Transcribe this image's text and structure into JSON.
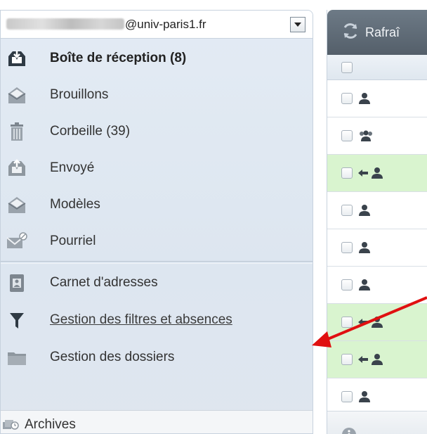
{
  "account": {
    "email_suffix": "@univ-paris1.fr"
  },
  "folders": [
    {
      "label": "Boîte de réception (8)",
      "icon": "inbox-icon",
      "selected": true
    },
    {
      "label": "Brouillons",
      "icon": "drafts-icon"
    },
    {
      "label": "Corbeille (39)",
      "icon": "trash-icon"
    },
    {
      "label": "Envoyé",
      "icon": "sent-icon"
    },
    {
      "label": "Modèles",
      "icon": "templates-icon"
    },
    {
      "label": "Pourriel",
      "icon": "spam-icon"
    }
  ],
  "tools": [
    {
      "label": "Carnet d'adresses",
      "icon": "address-book-icon"
    },
    {
      "label": "Gestion des filtres et absences",
      "icon": "filter-icon"
    },
    {
      "label": "Gestion des dossiers",
      "icon": "folder-icon"
    }
  ],
  "archives": {
    "label": "Archives",
    "icon": "archive-icon"
  },
  "message_toolbar": {
    "refresh_label": "Rafraî",
    "refresh_icon": "refresh-icon"
  },
  "message_rows": [
    {
      "icons": [
        "person-icon"
      ],
      "replied": false
    },
    {
      "icons": [
        "group-icon"
      ],
      "replied": false
    },
    {
      "icons": [
        "reply-arrow-icon",
        "person-icon"
      ],
      "replied": true
    },
    {
      "icons": [
        "person-icon"
      ],
      "replied": false
    },
    {
      "icons": [
        "person-icon"
      ],
      "replied": false
    },
    {
      "icons": [
        "person-icon"
      ],
      "replied": false
    },
    {
      "icons": [
        "reply-arrow-icon",
        "person-icon"
      ],
      "replied": true
    },
    {
      "icons": [
        "reply-arrow-icon",
        "person-icon"
      ],
      "replied": true
    },
    {
      "icons": [
        "person-icon"
      ],
      "replied": false
    }
  ],
  "colors": {
    "sidebar_bg": "#dde6f0",
    "toolbar_bg": "#5f6b76",
    "replied_row_bg": "#d9f4cf",
    "annotation_arrow": "#e01010"
  }
}
